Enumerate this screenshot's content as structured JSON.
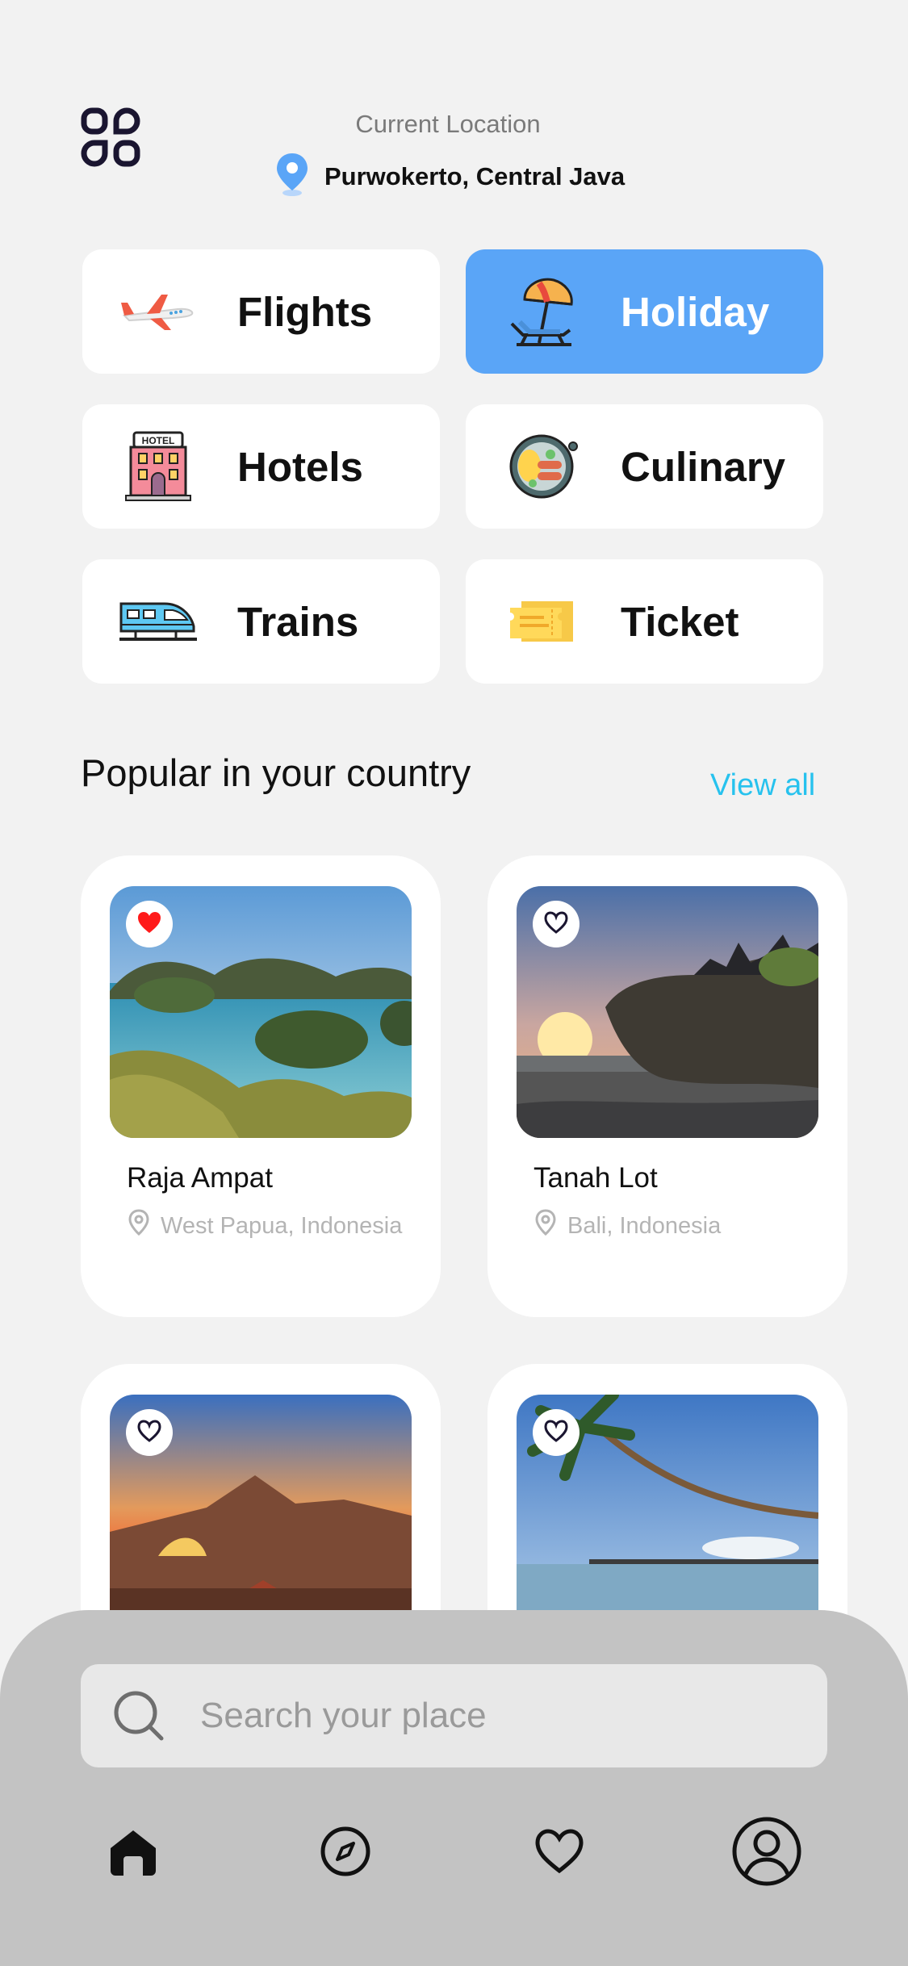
{
  "header": {
    "location_label": "Current Location",
    "location_value": "Purwokerto, Central Java"
  },
  "categories": [
    {
      "label": "Flights",
      "icon": "airplane-icon",
      "active": false
    },
    {
      "label": "Holiday",
      "icon": "beach-umbrella-icon",
      "active": true
    },
    {
      "label": "Hotels",
      "icon": "hotel-icon",
      "active": false
    },
    {
      "label": "Culinary",
      "icon": "food-pan-icon",
      "active": false
    },
    {
      "label": "Trains",
      "icon": "train-icon",
      "active": false
    },
    {
      "label": "Ticket",
      "icon": "ticket-icon",
      "active": false
    }
  ],
  "popular": {
    "title": "Popular in your country",
    "view_all": "View all",
    "places": [
      {
        "name": "Raja Ampat",
        "location": "West Papua, Indonesia",
        "favorited": true
      },
      {
        "name": "Tanah Lot",
        "location": "Bali, Indonesia",
        "favorited": false
      },
      {
        "name": "",
        "location": "",
        "favorited": false
      },
      {
        "name": "",
        "location": "",
        "favorited": false
      }
    ]
  },
  "search": {
    "placeholder": "Search your place"
  },
  "bottom_nav": [
    {
      "icon": "home-icon",
      "active": true
    },
    {
      "icon": "compass-icon",
      "active": false
    },
    {
      "icon": "heart-icon",
      "active": false
    },
    {
      "icon": "profile-icon",
      "active": false
    }
  ],
  "colors": {
    "accent": "#5aa5f7",
    "link": "#27c2ee",
    "favorite": "#ff1a1a",
    "background": "#f2f2f2",
    "sheet": "#c3c3c3"
  }
}
